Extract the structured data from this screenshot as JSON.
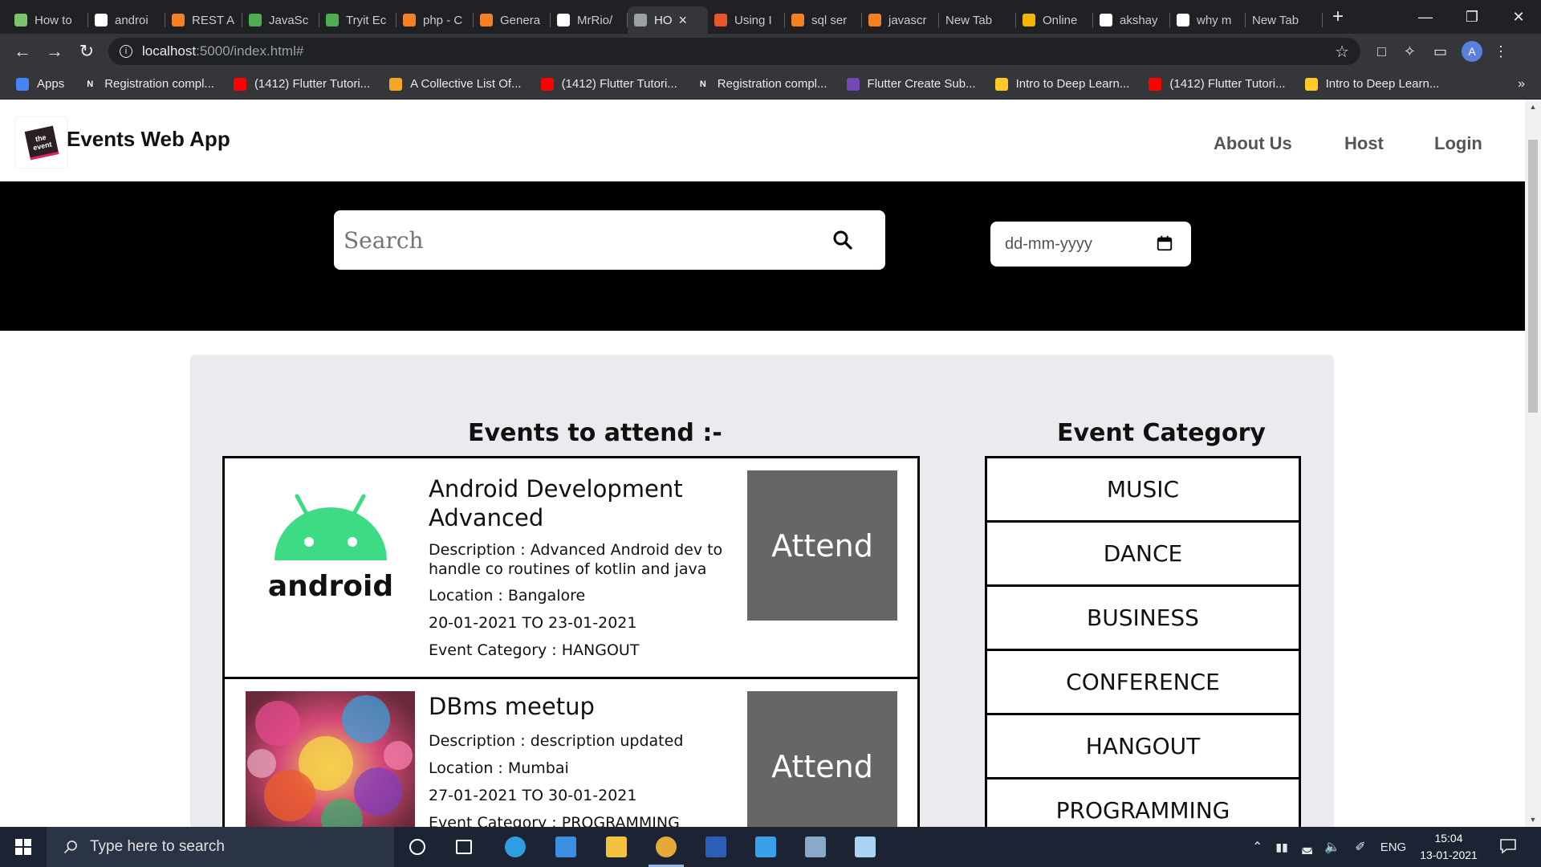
{
  "browser": {
    "tabs": [
      {
        "label": "How to",
        "icon": "vscode-ish-icon",
        "color": "#7cc36b"
      },
      {
        "label": "androi",
        "icon": "google-icon",
        "color": "#ffffff"
      },
      {
        "label": "REST A",
        "icon": "stackoverflow-icon",
        "color": "#f48024"
      },
      {
        "label": "JavaSc",
        "icon": "w3schools-icon",
        "color": "#4caf50"
      },
      {
        "label": "Tryit Ec",
        "icon": "w3schools-icon",
        "color": "#4caf50"
      },
      {
        "label": "php - C",
        "icon": "stackoverflow-icon",
        "color": "#f48024"
      },
      {
        "label": "Genera",
        "icon": "stackoverflow-icon",
        "color": "#f48024"
      },
      {
        "label": "MrRio/",
        "icon": "github-icon",
        "color": "#ffffff"
      },
      {
        "label": "HO",
        "icon": "globe-icon",
        "color": "#9aa0a6",
        "active": true
      },
      {
        "label": "Using I",
        "icon": "medium-icon",
        "color": "#e8572c"
      },
      {
        "label": "sql ser",
        "icon": "stackoverflow-icon",
        "color": "#f48024"
      },
      {
        "label": "javascr",
        "icon": "stackoverflow-icon",
        "color": "#f48024"
      },
      {
        "label": "New Tab",
        "icon": "",
        "color": ""
      },
      {
        "label": "Online",
        "icon": "slides-icon",
        "color": "#f4b400"
      },
      {
        "label": "akshay",
        "icon": "github-icon",
        "color": "#ffffff"
      },
      {
        "label": "why m",
        "icon": "google-icon",
        "color": "#ffffff"
      },
      {
        "label": "New Tab",
        "icon": "",
        "color": ""
      }
    ],
    "address": {
      "host": "localhost",
      "path": ":5000/index.html#"
    },
    "bookmarks": [
      {
        "label": "Apps",
        "icon": "apps-grid-icon"
      },
      {
        "label": "Registration compl...",
        "icon": "notion-icon"
      },
      {
        "label": "(1412) Flutter Tutori...",
        "icon": "youtube-icon"
      },
      {
        "label": "A Collective List Of...",
        "icon": "bookmark-icon"
      },
      {
        "label": "(1412) Flutter Tutori...",
        "icon": "youtube-icon"
      },
      {
        "label": "Registration compl...",
        "icon": "notion-icon"
      },
      {
        "label": "Flutter Create Sub...",
        "icon": "form-icon"
      },
      {
        "label": "Intro to Deep Learn...",
        "icon": "firebase-icon"
      },
      {
        "label": "(1412) Flutter Tutori...",
        "icon": "youtube-icon"
      },
      {
        "label": "Intro to Deep Learn...",
        "icon": "firebase-icon"
      }
    ],
    "avatar_letter": "A"
  },
  "site": {
    "brand": "Events Web App",
    "logo_text": "the event",
    "nav": [
      "About Us",
      "Host",
      "Login"
    ],
    "search_placeholder": "Search",
    "date_placeholder": "dd-mm-yyyy",
    "events_title": "Events to attend :-",
    "category_title": "Event Category",
    "events": [
      {
        "title": "Android Development Advanced",
        "description": "Description : Advanced Android dev to handle co routines of kotlin and java",
        "location": "Location : Bangalore",
        "dates": "20-01-2021 TO 23-01-2021",
        "category": "Event Category : HANGOUT",
        "image": "android-logo",
        "image_text": "android",
        "attend_label": "Attend"
      },
      {
        "title": "DBms meetup",
        "description": "Description : description updated",
        "location": "Location : Mumbai",
        "dates": "27-01-2021 TO 30-01-2021",
        "category": "Event Category : PROGRAMMING",
        "image": "colorful-powder-photo",
        "attend_label": "Attend"
      }
    ],
    "categories": [
      "MUSIC",
      "DANCE",
      "BUSINESS",
      "CONFERENCE",
      "HANGOUT",
      "PROGRAMMING"
    ],
    "colors": {
      "hero_bg": "#000000",
      "panel_bg": "#e9ebee",
      "attend_bg": "#666666",
      "android_green": "#3ddc84"
    }
  },
  "taskbar": {
    "search_placeholder": "Type here to search",
    "language": "ENG",
    "time": "15:04",
    "date": "13-01-2021",
    "apps": [
      "cortana-icon",
      "task-view-icon",
      "edge-icon",
      "mail-icon",
      "file-explorer-icon",
      "chrome-icon",
      "word-icon",
      "vscode-icon",
      "ssms-icon",
      "notepad-icon"
    ]
  }
}
